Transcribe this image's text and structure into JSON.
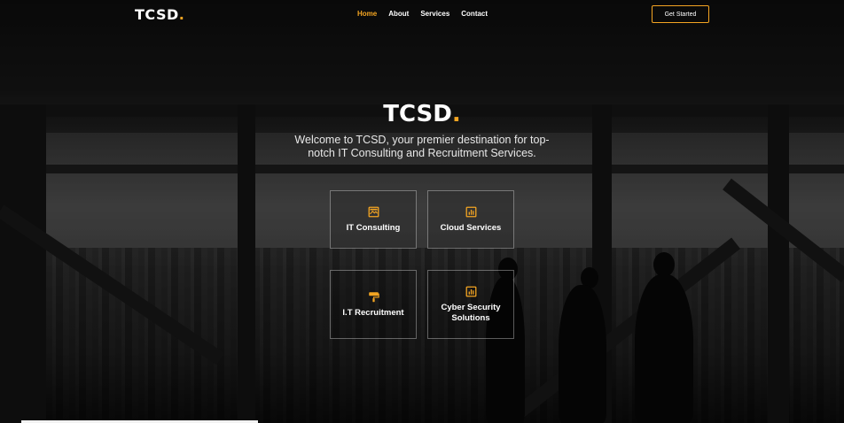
{
  "brand": {
    "name": "TCSD",
    "dot": ".",
    "accent": "#f4a522"
  },
  "nav": {
    "links": [
      {
        "label": "Home",
        "active": true
      },
      {
        "label": "About",
        "active": false
      },
      {
        "label": "Services",
        "active": false
      },
      {
        "label": "Contact",
        "active": false
      }
    ],
    "cta_label": "Get Started"
  },
  "hero": {
    "title": "TCSD",
    "title_dot": ".",
    "subtitle": "Welcome to TCSD, your premier destination for top-notch IT Consulting and Recruitment Services."
  },
  "services": [
    {
      "label": "IT Consulting",
      "icon": "image-icon"
    },
    {
      "label": "Cloud Services",
      "icon": "bar-chart-icon"
    },
    {
      "label": "I.T Recruitment",
      "icon": "paint-roller-icon"
    },
    {
      "label": "Cyber Security Solutions",
      "icon": "bar-chart-icon"
    }
  ]
}
